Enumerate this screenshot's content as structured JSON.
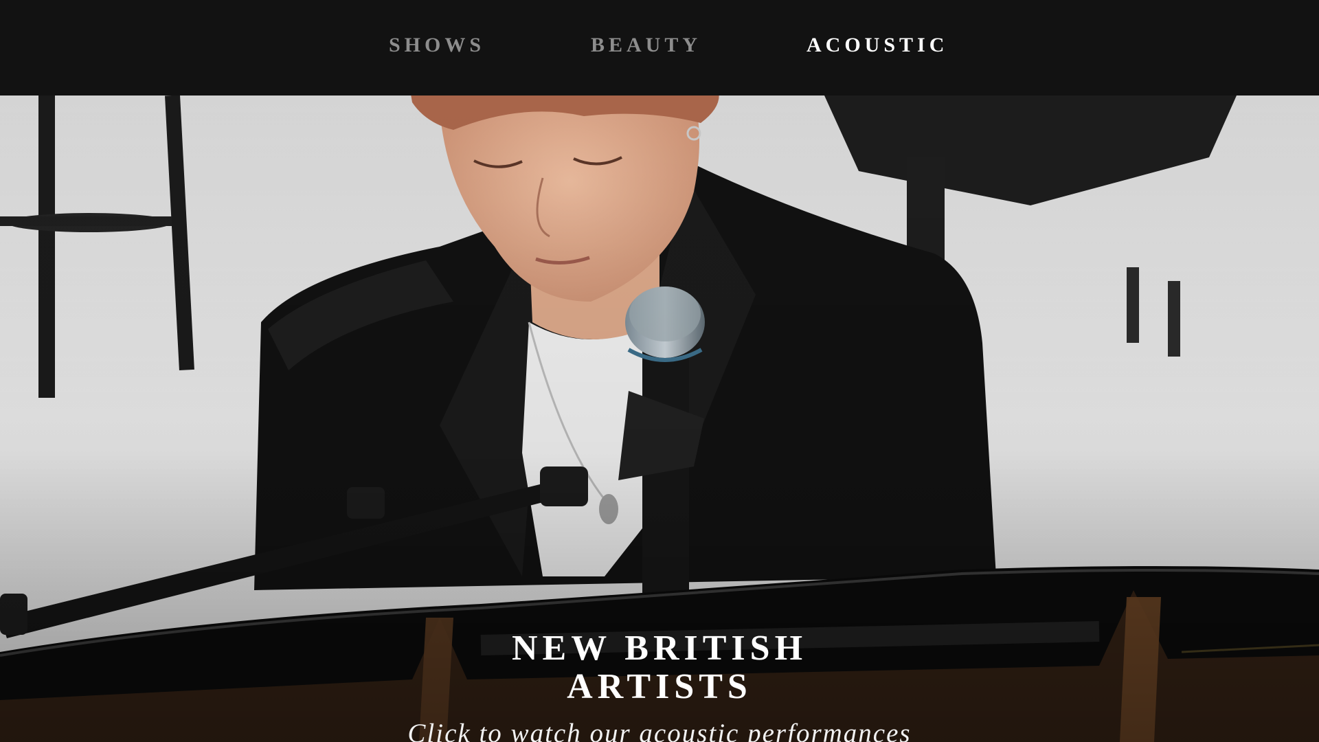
{
  "nav": {
    "items": [
      {
        "label": "SHOWS",
        "active": false
      },
      {
        "label": "BEAUTY",
        "active": false
      },
      {
        "label": "ACOUSTIC",
        "active": true
      }
    ],
    "active_color": "#ffffff",
    "inactive_color": "#8d8d8d",
    "background": "#121212"
  },
  "hero": {
    "title_line1": "NEW BRITISH",
    "title_line2": "ARTISTS",
    "subtitle": "Click to watch our acoustic performances"
  }
}
